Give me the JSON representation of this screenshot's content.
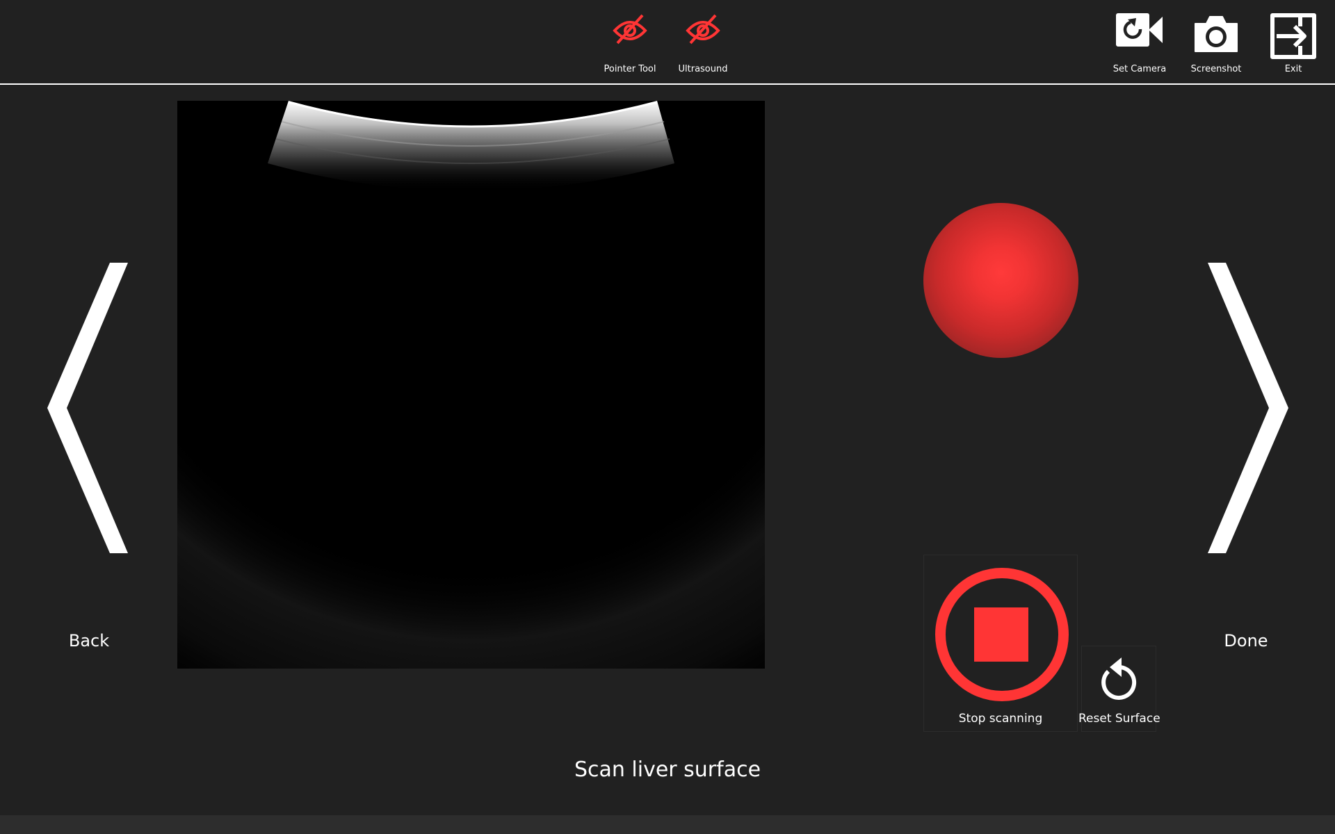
{
  "toolbar": {
    "pointer_tool_label": "Pointer Tool",
    "ultrasound_label": "Ultrasound",
    "set_camera_label": "Set Camera",
    "screenshot_label": "Screenshot",
    "exit_label": "Exit"
  },
  "icons": {
    "pointer_tool": "eye-slash-icon",
    "ultrasound": "eye-slash-icon",
    "set_camera": "camera-reset-icon",
    "screenshot": "camera-icon",
    "exit": "exit-icon",
    "reset_surface": "rotate-ccw-icon"
  },
  "navigation": {
    "back_label": "Back",
    "done_label": "Done"
  },
  "controls": {
    "stop_scanning_label": "Stop scanning",
    "reset_surface_label": "Reset Surface"
  },
  "status": {
    "scanning_indicator_color": "#ff3535"
  },
  "instruction": "Scan liver surface",
  "colors": {
    "background": "#212121",
    "accent_red": "#ff3535",
    "text": "#ffffff"
  }
}
